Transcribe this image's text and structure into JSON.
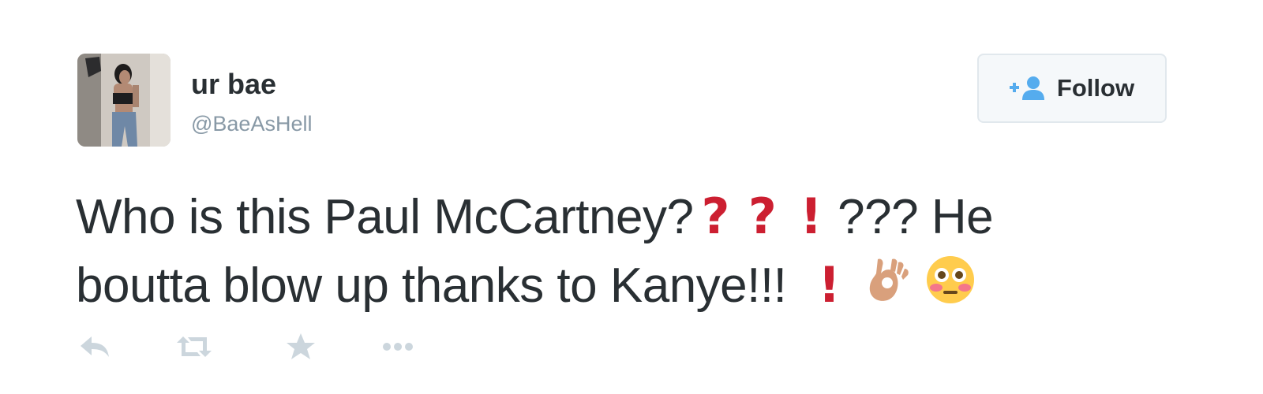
{
  "tweet": {
    "display_name": "ur bae",
    "handle": "@BaeAsHell",
    "follow_label": "Follow",
    "text_line1_a": "Who is this Paul McCartney?",
    "text_line1_b": "??? He",
    "text_line2_a": "boutta blow up thanks to Kanye!!!",
    "emoji": {
      "question_mark": "?",
      "exclamation_mark": "!"
    },
    "icons": {
      "follow": "add-user-icon",
      "reply": "reply-icon",
      "retweet": "retweet-icon",
      "favorite": "star-icon",
      "more": "more-dots-icon",
      "ok_hand": "ok-hand-emoji",
      "flushed": "flushed-face-emoji"
    },
    "colors": {
      "text": "#292f33",
      "secondary": "#8899a6",
      "follow_icon": "#55acee",
      "emoji_red": "#cc1f31",
      "action_icon": "#ccd6dd"
    }
  }
}
